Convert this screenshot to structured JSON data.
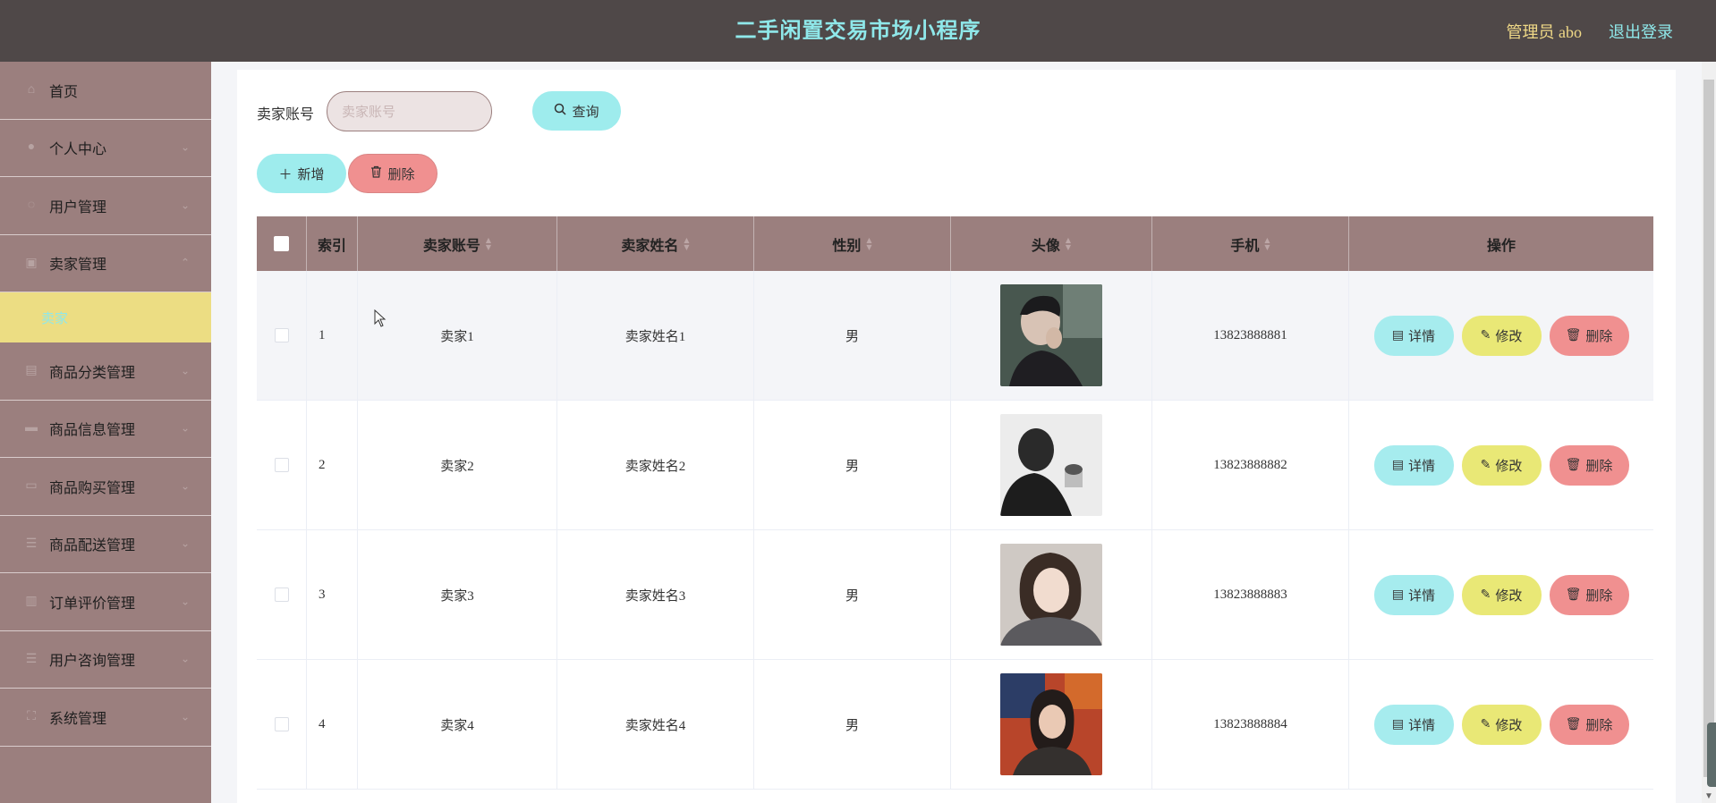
{
  "header": {
    "title": "二手闲置交易市场小程序",
    "admin": "管理员 abo",
    "logout": "退出登录"
  },
  "sidebar": {
    "items": [
      {
        "label": "首页",
        "icon": "home-icon",
        "arrow": false
      },
      {
        "label": "个人中心",
        "icon": "user-icon",
        "arrow": true
      },
      {
        "label": "用户管理",
        "icon": "users-icon",
        "arrow": true
      },
      {
        "label": "卖家管理",
        "icon": "seller-icon",
        "arrow": true,
        "expanded": true
      }
    ],
    "submenu": {
      "label": "卖家"
    },
    "items2": [
      {
        "label": "商品分类管理",
        "icon": "category-icon"
      },
      {
        "label": "商品信息管理",
        "icon": "goods-icon"
      },
      {
        "label": "商品购买管理",
        "icon": "purchase-icon"
      },
      {
        "label": "商品配送管理",
        "icon": "delivery-icon"
      },
      {
        "label": "订单评价管理",
        "icon": "review-icon"
      },
      {
        "label": "用户咨询管理",
        "icon": "consult-icon"
      },
      {
        "label": "系统管理",
        "icon": "system-icon"
      }
    ]
  },
  "search": {
    "label": "卖家账号",
    "placeholder": "卖家账号",
    "query_button": "查询"
  },
  "toolbar": {
    "add_label": "新增",
    "delete_label": "删除"
  },
  "table": {
    "columns": [
      "索引",
      "卖家账号",
      "卖家姓名",
      "性别",
      "头像",
      "手机",
      "操作"
    ],
    "rows": [
      {
        "index": "1",
        "account": "卖家1",
        "name": "卖家姓名1",
        "gender": "男",
        "phone": "13823888881"
      },
      {
        "index": "2",
        "account": "卖家2",
        "name": "卖家姓名2",
        "gender": "男",
        "phone": "13823888882"
      },
      {
        "index": "3",
        "account": "卖家3",
        "name": "卖家姓名3",
        "gender": "男",
        "phone": "13823888883"
      },
      {
        "index": "4",
        "account": "卖家4",
        "name": "卖家姓名4",
        "gender": "男",
        "phone": "13823888884"
      }
    ],
    "actions": {
      "detail": "详情",
      "edit": "修改",
      "delete": "删除"
    }
  },
  "colors": {
    "header_bg": "#4f4848",
    "sidebar_bg": "#9b7f7e",
    "accent_cyan": "#9eeced",
    "accent_yellow": "#e9e876",
    "accent_red": "#f09090",
    "active_submenu": "#ecdd83"
  }
}
